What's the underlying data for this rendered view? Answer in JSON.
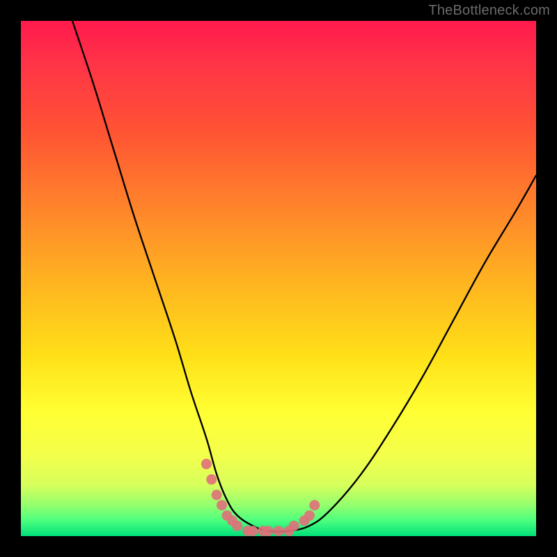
{
  "watermark": "TheBottleneck.com",
  "colors": {
    "frame": "#000000",
    "gradient_top": "#ff1a4d",
    "gradient_mid": "#ffe018",
    "gradient_bottom": "#00e07a",
    "curve": "#000000",
    "marker": "#e0707a"
  },
  "chart_data": {
    "type": "line",
    "title": "",
    "xlabel": "",
    "ylabel": "",
    "xlim": [
      0,
      100
    ],
    "ylim": [
      0,
      100
    ],
    "note": "Axes unlabeled; x and y are normalized percent of plot area. Low y = good (green), high y = bad (red). V-shaped bottleneck curve.",
    "series": [
      {
        "name": "bottleneck-curve",
        "x": [
          10,
          14,
          18,
          22,
          26,
          30,
          33,
          36,
          38,
          40,
          42,
          45,
          48,
          52,
          56,
          60,
          66,
          72,
          78,
          84,
          90,
          96,
          100
        ],
        "y": [
          100,
          88,
          75,
          62,
          50,
          38,
          28,
          19,
          12,
          7,
          4,
          2,
          1,
          1,
          2,
          5,
          12,
          21,
          31,
          42,
          53,
          63,
          70
        ]
      }
    ],
    "markers": {
      "name": "highlight-dots",
      "note": "Salmon/pink dots near the trough of the curve",
      "x": [
        36,
        37,
        38,
        39,
        40,
        41,
        42,
        44,
        45,
        47,
        48,
        50,
        52,
        53,
        55,
        56,
        57
      ],
      "y": [
        14,
        11,
        8,
        6,
        4,
        3,
        2,
        1,
        1,
        1,
        1,
        1,
        1,
        2,
        3,
        4,
        6
      ]
    }
  }
}
